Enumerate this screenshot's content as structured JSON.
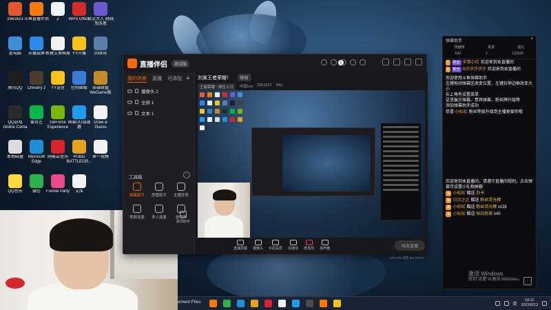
{
  "desktop": {
    "icons": [
      {
        "label": "2561623",
        "color": "#e5572f"
      },
      {
        "label": "斗鱼直播伴侣",
        "color": "#ff7a00"
      },
      {
        "label": "Z",
        "color": "#f2f2f2"
      },
      {
        "label": "WPS Office",
        "color": "#d62b2b"
      },
      {
        "label": "精灵大人 桃桃淘沃恩",
        "color": "#6a5acd"
      },
      {
        "label": "此电脑",
        "color": "#3c8fd8"
      },
      {
        "label": "乐播投屏",
        "color": "#2a8ae8"
      },
      {
        "label": "新建文本档案",
        "color": "#f2f2f2"
      },
      {
        "label": "YY开播",
        "color": "#f7c21c"
      },
      {
        "label": "回收站",
        "color": "#5b7fa6"
      },
      {
        "label": "腾讯QQ",
        "color": "#1f1f1f"
      },
      {
        "label": "Chivalry 2",
        "color": "#4a3b2a"
      },
      {
        "label": "YY语音",
        "color": "#f7c21c"
      },
      {
        "label": "控制面板",
        "color": "#3a7bd5"
      },
      {
        "label": "英雄联盟WeGame版",
        "color": "#c28a2a"
      },
      {
        "label": "QQ游戏 Online Coma",
        "color": "#2b2b2b"
      },
      {
        "label": "爱奇艺",
        "color": "#00b84a"
      },
      {
        "label": "GeForce Experience",
        "color": "#76b900"
      },
      {
        "label": "网易UU加速器",
        "color": "#1f9bef"
      },
      {
        "label": "Draw & Guess",
        "color": "#f4f4f4"
      },
      {
        "label": "本地磁盘",
        "color": "#dcdcdc"
      },
      {
        "label": "Microsoft Edge",
        "color": "#1b8fd8"
      },
      {
        "label": "网易云音乐",
        "color": "#d8232a"
      },
      {
        "label": "PUBG BATTLEGR...",
        "color": "#e8a11b"
      },
      {
        "label": "第一视角",
        "color": "#f2f2f2"
      },
      {
        "label": "QQ音乐",
        "color": "#ffd83a"
      },
      {
        "label": "微信",
        "color": "#2bb24c"
      },
      {
        "label": "Funnel Party",
        "color": "#e94b8a"
      },
      {
        "label": "文库",
        "color": "#f2f2f2"
      }
    ]
  },
  "app": {
    "name": "直播伴侣",
    "badge": "测试版",
    "scene_tabs": [
      {
        "label": "我的场景",
        "active": true
      },
      {
        "label": "直播",
        "active": false
      },
      {
        "label": "可添加",
        "active": false
      }
    ],
    "add_label": "+",
    "scenes": [
      {
        "label": "摄像头 2"
      },
      {
        "label": "全屏 1"
      },
      {
        "label": "文本 1"
      }
    ],
    "toolbox_title": "工具箱",
    "toolbox_collapse": "⋯",
    "tools": [
      {
        "label": "弹幕助手",
        "active": true
      },
      {
        "label": "房管助手",
        "active": false
      },
      {
        "label": "主播任务",
        "active": false
      },
      {
        "label": "视频连麦",
        "active": false
      },
      {
        "label": "多人连麦",
        "active": false
      },
      {
        "label": "游戏屏",
        "active": false
      }
    ],
    "side_tool": "歌词助手",
    "room": {
      "title": "刘某王者荣耀！",
      "edit_label": "修改",
      "category": "王者荣耀 · 排位上分",
      "room_id": "2561623",
      "viewers": "642",
      "fans": "中国xxx"
    },
    "controls": [
      {
        "label": "直播屏幕",
        "icon": "screen-icon"
      },
      {
        "label": "摄像头",
        "icon": "camera-icon"
      },
      {
        "label": "手机投屏",
        "icon": "phone-icon"
      },
      {
        "label": "多媒体",
        "icon": "media-icon"
      },
      {
        "label": "麦克风",
        "icon": "mic-icon"
      },
      {
        "label": "扬声器",
        "icon": "speaker-icon"
      }
    ],
    "live_button": "结束直播",
    "stats": "CPU 0% 内存 0% FPS 0"
  },
  "chat": {
    "title": "弹幕助手",
    "tabs": [
      "贡献榜",
      "贵宾",
      "送礼"
    ],
    "stats": [
      "642",
      "1",
      "132620"
    ],
    "messages": [
      {
        "level": "1",
        "fan": "粉丝",
        "user": "中惠小红",
        "text": "欢迎来到本直播间"
      },
      {
        "level": "5",
        "fan": "粉丝",
        "user": "B汐汐汐汐汐",
        "text": "欢迎来到本直播间"
      }
    ],
    "system": [
      "欢迎使用斗鱼弹幕助手",
      "左键拖动弹幕区改变位置，左键拉伸边框改变大小",
      "右上角有设置菜单",
      "这里展示弹幕、贵宾弹幕、粉丝牌升级等",
      "添加弹幕助手成功"
    ],
    "upgrade_user": "小松松",
    "upgrade_text": "粉丝等级升级到",
    "upgrade_note": "主播更爱你哦",
    "footer_system": "欢迎来到本直播间，请遵守直播间规则，点击弹幕可设置小礼物屏蔽",
    "gifts": [
      {
        "user": "小松松",
        "action": "赠送",
        "gift": "办卡"
      },
      {
        "user": "日日之之",
        "action": "赠送",
        "gift": "粉丝荧光棒"
      },
      {
        "user": "小松松",
        "action": "赠送",
        "gift": "粉丝荧光棒",
        "count": "x135"
      },
      {
        "user": "小松松",
        "action": "赠送",
        "gift": "秋日奶茶",
        "count": "x40"
      }
    ]
  },
  "watermark": {
    "line1": "激活 Windows",
    "line2": "转到\"设置\"以激活 Windows。"
  },
  "taskbar": {
    "text": "ement Files",
    "icons": [
      "#ff7a00",
      "#2bb24c",
      "#1b8fd8",
      "#e8a11b",
      "#d8232a",
      "#f2f2f2",
      "#1f9bef",
      "#4a4a4a",
      "#ff7a00",
      "#f7c21c"
    ],
    "lang": "英",
    "time": "18:11",
    "date": "2022/6/12"
  }
}
